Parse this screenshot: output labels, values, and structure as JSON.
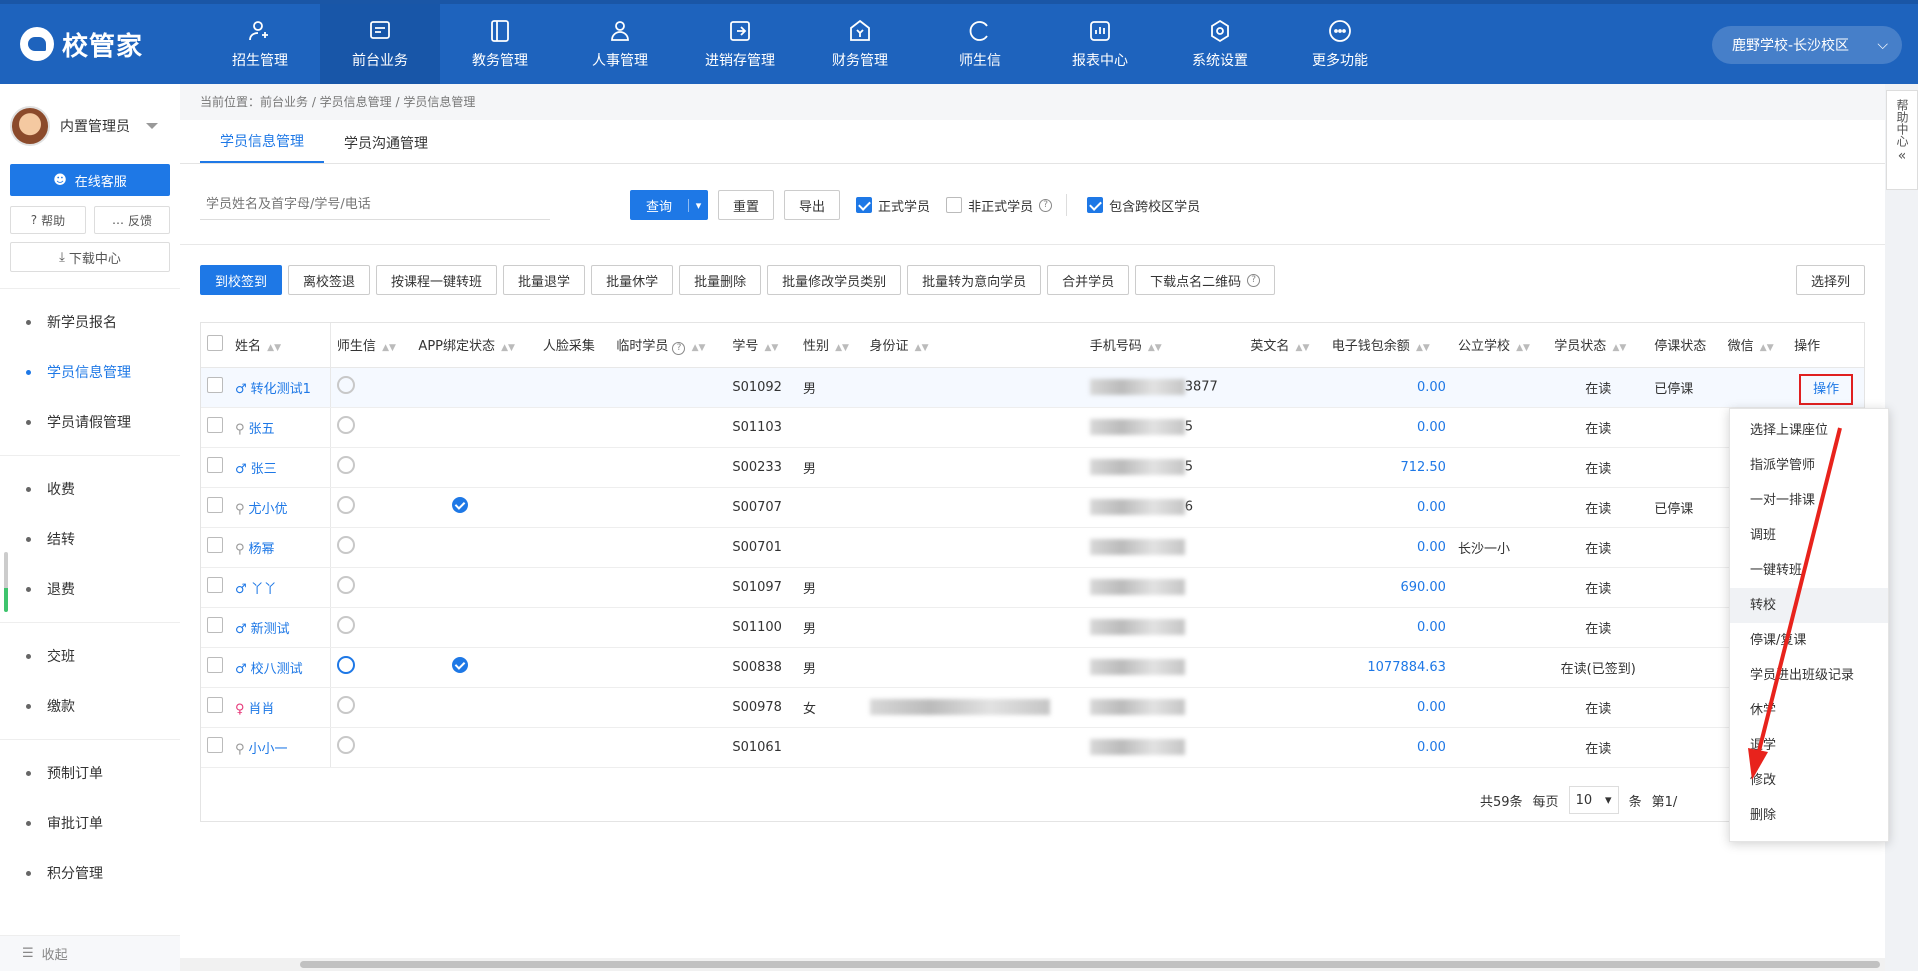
{
  "app": {
    "logo_text": "校管家",
    "campus": "鹿野学校-长沙校区"
  },
  "nav": [
    {
      "label": "招生管理",
      "icon": "user-add-icon"
    },
    {
      "label": "前台业务",
      "icon": "desk-icon",
      "active": true
    },
    {
      "label": "教务管理",
      "icon": "book-icon"
    },
    {
      "label": "人事管理",
      "icon": "person-icon"
    },
    {
      "label": "进销存管理",
      "icon": "inventory-icon"
    },
    {
      "label": "财务管理",
      "icon": "finance-icon"
    },
    {
      "label": "师生信",
      "icon": "message-icon"
    },
    {
      "label": "报表中心",
      "icon": "report-icon"
    },
    {
      "label": "系统设置",
      "icon": "settings-icon"
    },
    {
      "label": "更多功能",
      "icon": "more-icon"
    }
  ],
  "sidebar": {
    "user_name": "内置管理员",
    "service": "在线客服",
    "help": "帮助",
    "feedback": "反馈",
    "download": "下载中心",
    "groups": [
      [
        "新学员报名",
        "学员信息管理",
        "学员请假管理"
      ],
      [
        "收费",
        "结转",
        "退费"
      ],
      [
        "交班",
        "缴款"
      ],
      [
        "预制订单",
        "审批订单",
        "积分管理"
      ]
    ],
    "active": "学员信息管理",
    "collapse": "收起"
  },
  "main": {
    "breadcrumb": "当前位置：前台业务 / 学员信息管理 / 学员信息管理",
    "tabs": [
      "学员信息管理",
      "学员沟通管理"
    ],
    "search_placeholder": "学员姓名及首字母/学号/电话",
    "query": "查询",
    "reset": "重置",
    "export": "导出",
    "chk_formal": "正式学员",
    "chk_informal": "非正式学员",
    "chk_cross": "包含跨校区学员",
    "actions": [
      "到校签到",
      "离校签退",
      "按课程一键转班",
      "批量退学",
      "批量休学",
      "批量删除",
      "批量修改学员类别",
      "批量转为意向学员",
      "合并学员",
      "下载点名二维码"
    ],
    "select_columns": "选择列"
  },
  "table": {
    "headers": [
      "姓名",
      "师生信",
      "APP绑定状态",
      "人脸采集",
      "临时学员",
      "学号",
      "性别",
      "身份证",
      "手机号码",
      "英文名",
      "电子钱包余额",
      "公立学校",
      "学员状态",
      "停课状态",
      "微信",
      "操作"
    ],
    "rows": [
      {
        "gender": "m",
        "name": "转化测试1",
        "wx_on": false,
        "app": false,
        "id": "S01092",
        "sex": "男",
        "phone_tail": "3877",
        "balance": "0.00",
        "school": "",
        "status": "在读",
        "stop": "已停课",
        "op": "操作"
      },
      {
        "gender": "n",
        "name": "张五",
        "wx_on": false,
        "app": false,
        "id": "S01103",
        "sex": "",
        "phone_tail": "5",
        "balance": "0.00",
        "school": "",
        "status": "在读",
        "stop": "",
        "op": ""
      },
      {
        "gender": "m",
        "name": "张三",
        "wx_on": false,
        "app": false,
        "id": "S00233",
        "sex": "男",
        "phone_tail": "5",
        "balance": "712.50",
        "school": "",
        "status": "在读",
        "stop": "",
        "op": ""
      },
      {
        "gender": "n",
        "name": "尤小优",
        "wx_on": false,
        "app": true,
        "id": "S00707",
        "sex": "",
        "phone_tail": "6",
        "balance": "0.00",
        "school": "",
        "status": "在读",
        "stop": "已停课",
        "op": ""
      },
      {
        "gender": "n",
        "name": "杨幂",
        "wx_on": false,
        "app": false,
        "id": "S00701",
        "sex": "",
        "phone_tail": "",
        "balance": "0.00",
        "school": "长沙一小",
        "status": "在读",
        "stop": "",
        "op": ""
      },
      {
        "gender": "m",
        "name": "丫丫",
        "wx_on": false,
        "app": false,
        "id": "S01097",
        "sex": "男",
        "phone_tail": "",
        "balance": "690.00",
        "school": "",
        "status": "在读",
        "stop": "",
        "op": ""
      },
      {
        "gender": "m",
        "name": "新测试",
        "wx_on": false,
        "app": false,
        "id": "S01100",
        "sex": "男",
        "phone_tail": "",
        "balance": "0.00",
        "school": "",
        "status": "在读",
        "stop": "",
        "op": ""
      },
      {
        "gender": "m",
        "name": "校八测试",
        "wx_on": true,
        "app": true,
        "id": "S00838",
        "sex": "男",
        "phone_tail": "",
        "balance": "1077884.63",
        "school": "",
        "status": "在读(已签到)",
        "stop": "",
        "op": ""
      },
      {
        "gender": "f",
        "name": "肖肖",
        "wx_on": false,
        "app": false,
        "id": "S00978",
        "sex": "女",
        "phone_tail": "",
        "balance": "0.00",
        "school": "",
        "status": "在读",
        "stop": "",
        "op": ""
      },
      {
        "gender": "n",
        "name": "小小一",
        "wx_on": false,
        "app": false,
        "id": "S01061",
        "sex": "",
        "phone_tail": "",
        "balance": "0.00",
        "school": "",
        "status": "在读",
        "stop": "",
        "op": ""
      }
    ]
  },
  "pager": {
    "total": "共59条",
    "per_page_label": "每页",
    "per_page": "10",
    "unit": "条",
    "page": "第1/"
  },
  "dropdown": [
    "选择上课座位",
    "指派学管师",
    "一对一排课",
    "调班",
    "一键转班",
    "转校",
    "停课/复课",
    "学员进出班级记录",
    "休学",
    "退学",
    "修改",
    "删除"
  ],
  "help_tab": "帮助中心"
}
